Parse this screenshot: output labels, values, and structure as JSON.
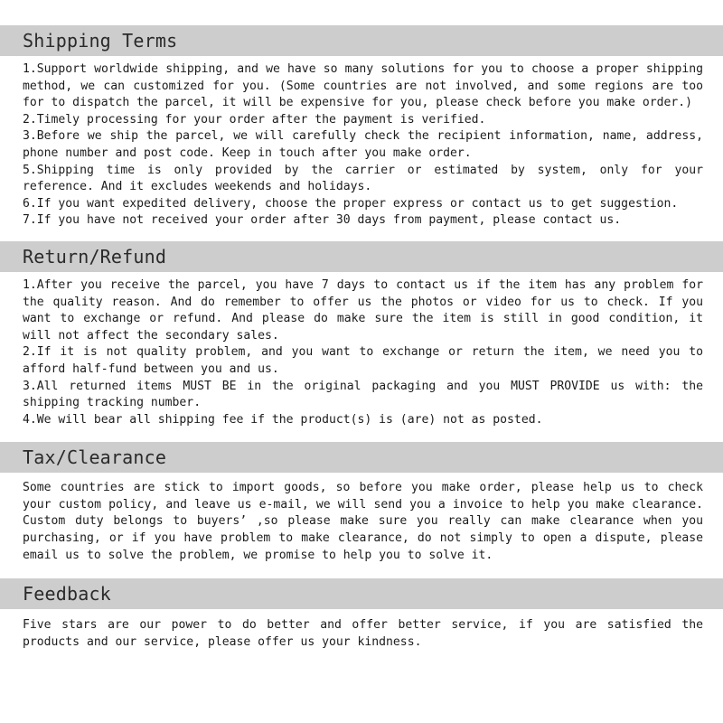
{
  "document": {
    "type": "store-policy-banner",
    "background_color": "#ffffff",
    "text_color": "#1b1b1b",
    "header_bar_color": "#cdcdcd"
  },
  "sections": [
    {
      "id": "shipping-terms",
      "title": "Shipping Terms",
      "body": "1.Support worldwide shipping, and we have so many solutions for you to choose a proper shipping method, we can customized for you. (Some countries are not involved, and some regions are too for to dispatch the parcel, it will be expensive for you, please check before you make order.)\n2.Timely processing for your order after the payment is verified.\n3.Before we ship the parcel, we will carefully check the recipient information, name, address, phone number and post code. Keep in touch after you make order.\n5.Shipping time is only provided by the carrier or estimated by system, only for your reference. And it excludes weekends and holidays.\n6.If you want expedited delivery, choose the proper express or contact us to get suggestion.\n7.If you have not received your order after 30 days from payment, please contact us."
    },
    {
      "id": "return-refund",
      "title": "Return/Refund",
      "body": "1.After you receive the parcel, you have 7 days to contact us if the item has any problem for the quality reason. And do remember to offer us the photos or video for us to check. If you want to exchange or refund. And please do make sure the item is still in good condition, it will not affect the secondary sales.\n2.If it is not quality problem, and you want to exchange or return the item, we need you to afford half-fund between you and us.\n3.All returned items MUST BE in the original packaging and you MUST PROVIDE us with: the shipping tracking number.\n4.We will bear all shipping fee if the product(s) is (are) not as posted."
    },
    {
      "id": "tax-clearance",
      "title": "Tax/Clearance",
      "body": "Some countries are stick to import goods, so before you make order, please help us to check your custom policy, and leave us e-mail, we will send you a invoice to help you make clearance. Custom duty belongs to buyers’ ,so please make sure you really can make clearance when you purchasing, or if you have problem to make clearance, do not simply to open a dispute, please email us to solve the problem, we promise to help you to solve it."
    },
    {
      "id": "feedback",
      "title": "Feedback",
      "body": "Five stars are our power to do better and offer better service, if you are satisfied the products and our service, please offer us your kindness."
    }
  ]
}
